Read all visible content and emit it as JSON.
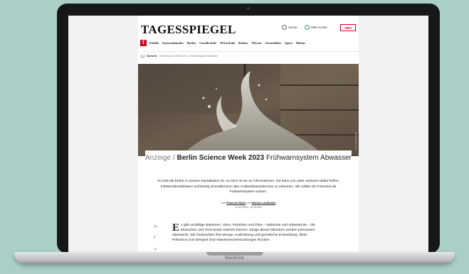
{
  "header": {
    "logo": "TAGESSPIEGEL",
    "search_label": "Suche",
    "account_label": "Mein Konto",
    "abo_label": "ABO"
  },
  "nav": {
    "brand_glyph": "T",
    "items": [
      "Politik",
      "Internationales",
      "Berlin",
      "Gesellschaft",
      "Wirtschaft",
      "Kultur",
      "Wissen",
      "Gesundheit",
      "Sport",
      "Meinu"
    ]
  },
  "breadcrumb": {
    "home": "Startseite",
    "current": "Berlin Science Week 2023 – Frühwarnsystem Abwasser"
  },
  "hero": {
    "credit": "Foto: Getty Images"
  },
  "headline": {
    "prefix": "Anzeige /",
    "kicker": "Berlin Science Week 2023",
    "title": "Frühwarnsystem Abwasser"
  },
  "teaser": "So trüb die Brühe in unserer Kanalisation ist, so reich ist sie an Informationen. Sie kann uns unter anderem dabei helfen, Infektionskrankheiten rechtzeitig einzudämmen oder Antibiotikaresistenzen zu erkennen. Wir sollten ihr Potenzial als Frühwarnsystem nutzen.",
  "byline": {
    "prefix": "Von",
    "author1": "Emanuel Wyler",
    "joiner": "und",
    "author2": "Markus Landthaler",
    "date": "11.10.2023, 12:25 Uhr"
  },
  "share": {
    "icons": [
      "mail-icon",
      "facebook-icon",
      "x-icon"
    ],
    "glyphs": [
      "✉",
      "f",
      "✕"
    ]
  },
  "article": {
    "dropcap": "E",
    "body": "s gibt unzählige Bakterien, Viren, Parasiten und Pilze – bekannte und unbekannte – die Menschen und Tiere krank machen können. Einige dieser Mikroben werden permanent überwacht. Wir beobachten ihre Menge, Ausbreitung und genetische Entwicklung. Beim Poliovirus zum Beispiel sind Abwasseruntersuchungen Routine."
  },
  "device": {
    "label": "MacBook"
  }
}
